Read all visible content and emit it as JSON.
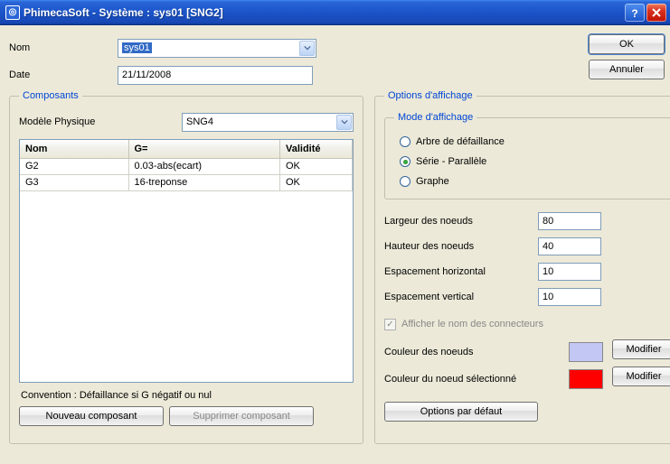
{
  "window": {
    "title": "PhimecaSoft - Système : sys01 [SNG2]"
  },
  "buttons": {
    "ok": "OK",
    "cancel": "Annuler",
    "new_component": "Nouveau composant",
    "delete_component": "Supprimer composant",
    "modify": "Modifier",
    "defaults": "Options par défaut"
  },
  "form": {
    "name_label": "Nom",
    "name_value": "sys01",
    "date_label": "Date",
    "date_value": "21/11/2008"
  },
  "composants": {
    "legend": "Composants",
    "model_label": "Modèle Physique",
    "model_value": "SNG4",
    "columns": {
      "nom": "Nom",
      "g": "G=",
      "validite": "Validité"
    },
    "rows": [
      {
        "nom": "G2",
        "g": "0.03-abs(ecart)",
        "validite": "OK"
      },
      {
        "nom": "G3",
        "g": "16-treponse",
        "validite": "OK"
      }
    ],
    "convention": "Convention : Défaillance si G négatif ou nul"
  },
  "options": {
    "legend": "Options d'affichage",
    "mode_legend": "Mode d'affichage",
    "modes": {
      "tree": "Arbre de défaillance",
      "serie": "Série - Parallèle",
      "graph": "Graphe"
    },
    "mode_selected": "serie",
    "params": {
      "node_width_label": "Largeur des noeuds",
      "node_width": "80",
      "node_height_label": "Hauteur des noeuds",
      "node_height": "40",
      "hspacing_label": "Espacement horizontal",
      "hspacing": "10",
      "vspacing_label": "Espacement vertical",
      "vspacing": "10"
    },
    "show_connectors_label": "Afficher le nom des connecteurs",
    "node_color_label": "Couleur des noeuds",
    "node_color": "#c3c7f4",
    "sel_node_color_label": "Couleur du noeud sélectionné",
    "sel_node_color": "#ff0000"
  }
}
